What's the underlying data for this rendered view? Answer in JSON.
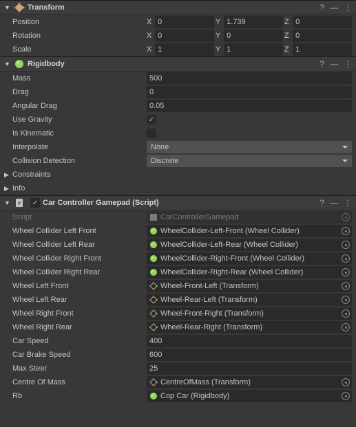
{
  "transform": {
    "title": "Transform",
    "position": {
      "label": "Position",
      "x": "0",
      "y": "1.739",
      "z": "0"
    },
    "rotation": {
      "label": "Rotation",
      "x": "0",
      "y": "0",
      "z": "0"
    },
    "scale": {
      "label": "Scale",
      "x": "1",
      "y": "1",
      "z": "1"
    },
    "axes": {
      "x": "X",
      "y": "Y",
      "z": "Z"
    }
  },
  "rigidbody": {
    "title": "Rigidbody",
    "mass": {
      "label": "Mass",
      "value": "500"
    },
    "drag": {
      "label": "Drag",
      "value": "0"
    },
    "angularDrag": {
      "label": "Angular Drag",
      "value": "0.05"
    },
    "useGravity": {
      "label": "Use Gravity",
      "checked": true
    },
    "isKinematic": {
      "label": "Is Kinematic",
      "checked": false
    },
    "interpolate": {
      "label": "Interpolate",
      "value": "None"
    },
    "collisionDetection": {
      "label": "Collision Detection",
      "value": "Discrete"
    },
    "constraints": {
      "label": "Constraints"
    },
    "info": {
      "label": "Info"
    }
  },
  "script": {
    "title": "Car Controller Gamepad (Script)",
    "enabled": true,
    "scriptField": {
      "label": "Script",
      "value": "CarControllerGamepad"
    },
    "fields": [
      {
        "label": "Wheel Collider Left Front",
        "value": "WheelCollider-Left-Front (Wheel Collider)",
        "iconType": "gameobject"
      },
      {
        "label": "Wheel Collider Left Rear",
        "value": "WheelCollider-Left-Rear (Wheel Collider)",
        "iconType": "gameobject"
      },
      {
        "label": "Wheel Collider Right Front",
        "value": "WheelCollider-Right-Front (Wheel Collider)",
        "iconType": "gameobject"
      },
      {
        "label": "Wheel Collider Right Rear",
        "value": "WheelCollider-Right-Rear (Wheel Collider)",
        "iconType": "gameobject"
      },
      {
        "label": "Wheel Left Front",
        "value": "Wheel-Front-Left (Transform)",
        "iconType": "transform"
      },
      {
        "label": "Wheel Left Rear",
        "value": "Wheel-Rear-Left (Transform)",
        "iconType": "transform"
      },
      {
        "label": "Wheel Right Front",
        "value": "Wheel-Front-Right (Transform)",
        "iconType": "transform"
      },
      {
        "label": "Wheel Right Rear",
        "value": "Wheel-Rear-Right (Transform)",
        "iconType": "transform"
      }
    ],
    "numberFields": [
      {
        "label": "Car Speed",
        "value": "400"
      },
      {
        "label": "Car Brake Speed",
        "value": "600"
      },
      {
        "label": "Max Steer",
        "value": "25"
      }
    ],
    "centreOfMass": {
      "label": "Centre Of Mass",
      "value": "CentreOfMass (Transform)",
      "iconType": "transform"
    },
    "rb": {
      "label": "Rb",
      "value": "Cop Car (Rigidbody)",
      "iconType": "rigidbody"
    }
  }
}
